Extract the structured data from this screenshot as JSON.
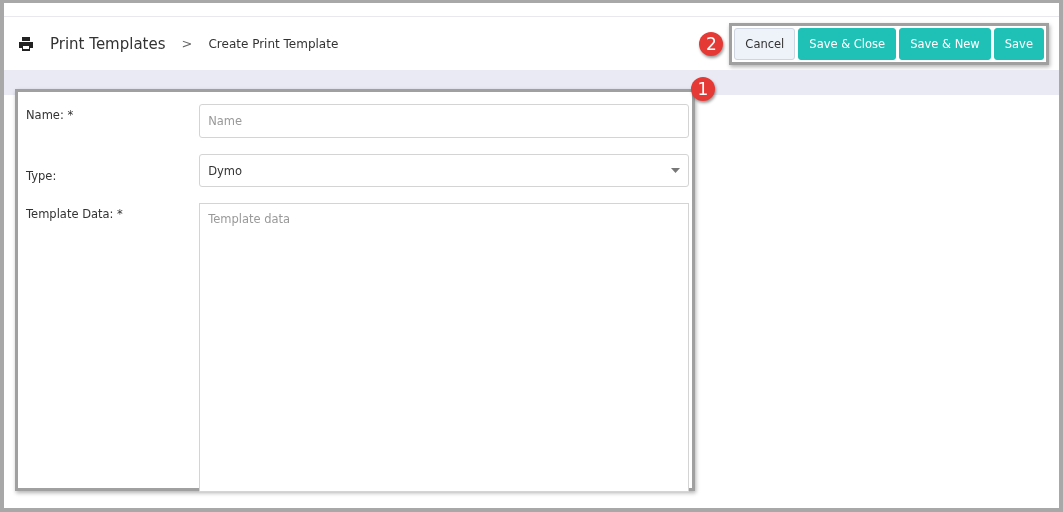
{
  "breadcrumb": {
    "title": "Print Templates",
    "separator": ">",
    "current": "Create Print Template"
  },
  "buttons": [
    {
      "label": "Cancel",
      "kind": "secondary"
    },
    {
      "label": "Save & Close",
      "kind": "primary"
    },
    {
      "label": "Save & New",
      "kind": "primary"
    },
    {
      "label": "Save",
      "kind": "primary"
    }
  ],
  "form": {
    "fields": [
      {
        "label": "Name: *",
        "kind": "text",
        "placeholder": "Name"
      },
      {
        "label": "Type:",
        "kind": "select",
        "value": "Dymo"
      },
      {
        "label": "Template Data: *",
        "kind": "textarea",
        "placeholder": "Template data"
      }
    ]
  },
  "callouts": [
    "1",
    "2"
  ]
}
